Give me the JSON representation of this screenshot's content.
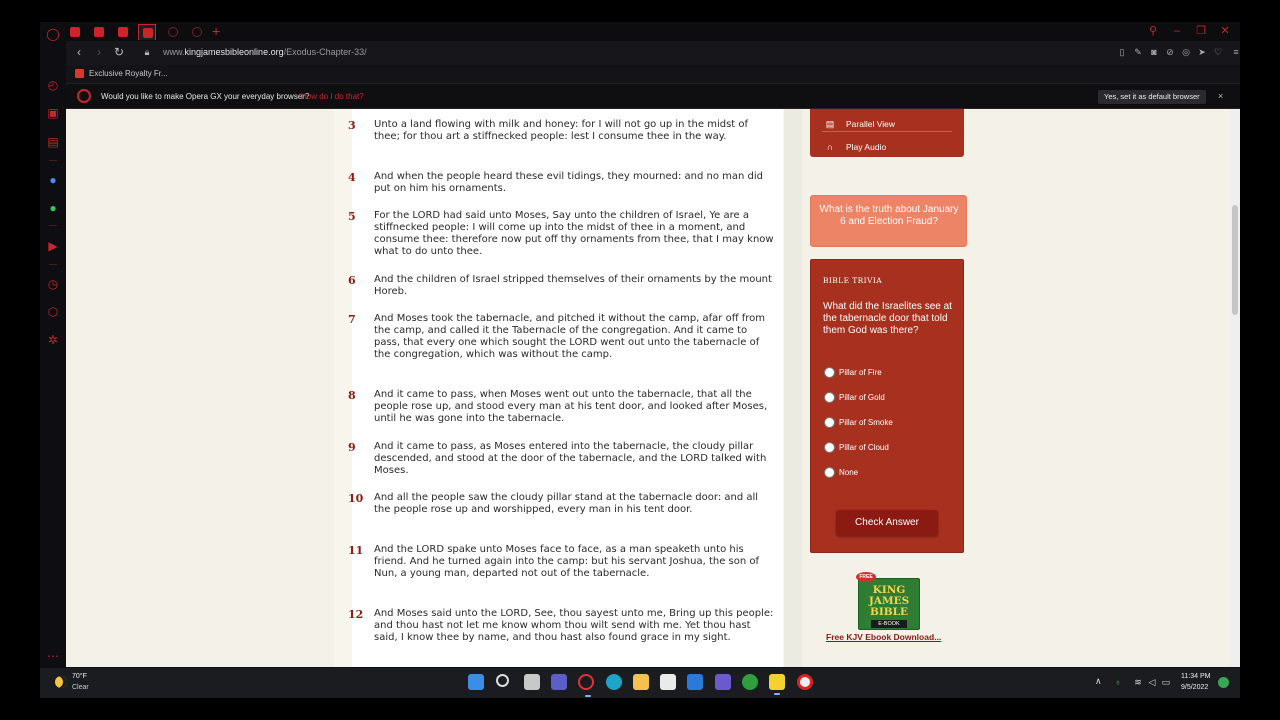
{
  "browser": {
    "url_prefix": "www.",
    "url_host": "kingjamesbibleonline.org",
    "url_path": "/Exodus-Chapter-33/",
    "bookmark_label": "Exclusive Royalty Fr...",
    "default_prompt": "Would you like to make Opera GX your everyday browser?",
    "default_link": "How do I do that?",
    "default_yes": "Yes, set it as default browser",
    "close_glyph": "×",
    "add_tab_glyph": "+"
  },
  "verses": [
    {
      "num": "3",
      "text": "Unto a land flowing with milk and honey: for I will not go up in the midst of thee; for thou art a stiffnecked people: lest I consume thee in the way."
    },
    {
      "num": "4",
      "text": "And when the people heard these evil tidings, they mourned: and no man did put on him his ornaments."
    },
    {
      "num": "5",
      "text": "For the LORD had said unto Moses, Say unto the children of Israel, Ye are a stiffnecked people: I will come up into the midst of thee in a moment, and consume thee: therefore now put off thy ornaments from thee, that I may know what to do unto thee."
    },
    {
      "num": "6",
      "text": "And the children of Israel stripped themselves of their ornaments by the mount Horeb."
    },
    {
      "num": "7",
      "text": "And Moses took the tabernacle, and pitched it without the camp, afar off from the camp, and called it the Tabernacle of the congregation. And it came to pass, that every one which sought the LORD went out unto the tabernacle of the congregation, which was without the camp."
    },
    {
      "num": "8",
      "text": "And it came to pass, when Moses went out unto the tabernacle, that all the people rose up, and stood every man at his tent door, and looked after Moses, until he was gone into the tabernacle."
    },
    {
      "num": "9",
      "text": "And it came to pass, as Moses entered into the tabernacle, the cloudy pillar descended, and stood at the door of the tabernacle, and the LORD talked with Moses."
    },
    {
      "num": "10",
      "text": "And all the people saw the cloudy pillar stand at the tabernacle door: and all the people rose up and worshipped, every man in his tent door."
    },
    {
      "num": "11",
      "text": "And the LORD spake unto Moses face to face, as a man speaketh unto his friend. And he turned again into the camp: but his servant Joshua, the son of Nun, a young man, departed not out of the tabernacle."
    },
    {
      "num": "12",
      "text": "And Moses said unto the LORD, See, thou sayest unto me, Bring up this people: and thou hast not let me know whom thou wilt send with me. Yet thou hast said, I know thee by name, and thou hast also found grace in my sight."
    }
  ],
  "sidebar": {
    "menu": [
      {
        "label": "Parallel View",
        "icon": "book-icon"
      },
      {
        "label": "Play Audio",
        "icon": "headphones-icon"
      }
    ],
    "truth_button": "What is the truth about January 6 and Election Fraud?",
    "trivia": {
      "heading": "BIBLE TRIVIA",
      "question": "What did the Israelites see at the tabernacle door that told them God was there?",
      "options": [
        "Pillar of Fire",
        "Pillar of Gold",
        "Pillar of Smoke",
        "Pillar of Cloud",
        "None"
      ],
      "check_button": "Check Answer"
    },
    "ebook": {
      "free_badge": "FREE",
      "title": "KING JAMES BIBLE",
      "subtitle": "E-BOOK",
      "link": "Free KJV Ebook Download..."
    }
  },
  "taskbar": {
    "temperature": "70°F",
    "condition": "Clear",
    "time": "11:34 PM",
    "date": "9/5/2022"
  }
}
